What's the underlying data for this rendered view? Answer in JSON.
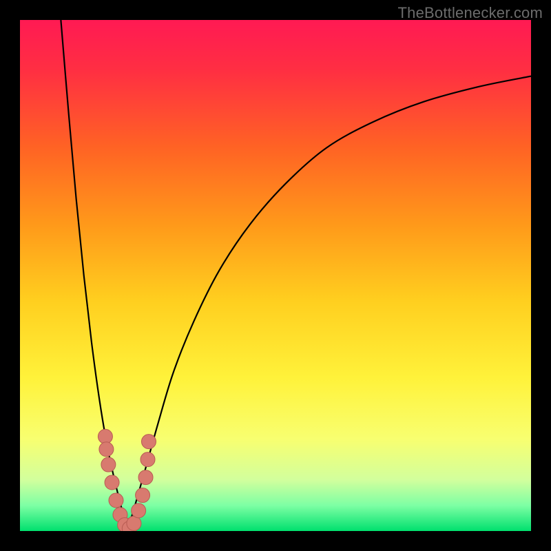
{
  "watermark": "TheBottlenecker.com",
  "colors": {
    "black": "#000000",
    "curve": "#000000",
    "marker": "#d87a6f",
    "marker_stroke": "#b75b52",
    "gradient_stops": [
      {
        "offset": 0.0,
        "color": "#ff1a53"
      },
      {
        "offset": 0.1,
        "color": "#ff2f42"
      },
      {
        "offset": 0.25,
        "color": "#ff6324"
      },
      {
        "offset": 0.4,
        "color": "#ff991a"
      },
      {
        "offset": 0.55,
        "color": "#ffcf1f"
      },
      {
        "offset": 0.7,
        "color": "#fff23a"
      },
      {
        "offset": 0.82,
        "color": "#f8ff70"
      },
      {
        "offset": 0.9,
        "color": "#d2ff9d"
      },
      {
        "offset": 0.95,
        "color": "#7dffa4"
      },
      {
        "offset": 1.0,
        "color": "#00e06e"
      }
    ]
  },
  "chart_data": {
    "type": "line",
    "title": "",
    "xlabel": "",
    "ylabel": "",
    "xlim": [
      0,
      100
    ],
    "ylim": [
      0,
      100
    ],
    "grid": false,
    "series": [
      {
        "name": "left-branch",
        "x": [
          8.0,
          9.5,
          11.0,
          12.5,
          14.0,
          15.5,
          17.0,
          18.5,
          20.0,
          21.0
        ],
        "y": [
          100,
          82,
          65,
          50,
          37,
          26,
          17,
          10,
          4,
          0
        ]
      },
      {
        "name": "right-branch",
        "x": [
          21.0,
          22.5,
          24.5,
          27.0,
          30.0,
          34.0,
          39.0,
          45.0,
          52.0,
          60.0,
          69.0,
          79.0,
          90.0,
          100.0
        ],
        "y": [
          0,
          5,
          12,
          21,
          31,
          41,
          51,
          60,
          68,
          75,
          80,
          84,
          87,
          89
        ]
      }
    ],
    "markers": {
      "name": "highlight-points",
      "x": [
        16.7,
        16.9,
        17.3,
        18.0,
        18.8,
        19.6,
        20.5,
        21.4,
        22.3,
        23.2,
        24.0,
        24.6,
        25.0,
        25.2
      ],
      "y": [
        18.5,
        16.0,
        13.0,
        9.5,
        6.0,
        3.2,
        1.2,
        0.5,
        1.5,
        4.0,
        7.0,
        10.5,
        14.0,
        17.5
      ]
    }
  }
}
